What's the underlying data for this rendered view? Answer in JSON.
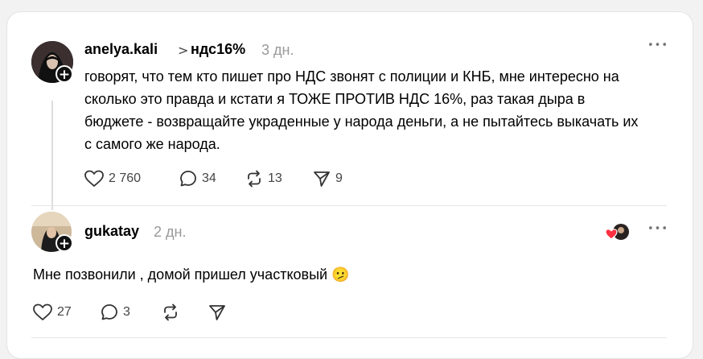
{
  "post": {
    "username": "anelya.kali",
    "separator": ">",
    "topic": "ндс16%",
    "time": "3 дн.",
    "text": "говорят, что тем кто пишет про НДС звонят с полиции и КНБ, мне интересно на сколько это правда и кстати я ТОЖЕ ПРОТИВ НДС 16%, раз такая дыра в бюджете - возвращайте украденные у народа деньги, а не пытайтесь выкачать их с самого же народа.",
    "likes": "2 760",
    "comments": "34",
    "reposts": "13",
    "shares": "9",
    "more": "•••"
  },
  "reply": {
    "username": "gukatay",
    "time": "2 дн.",
    "text": "Мне позвонили , домой пришел участковый",
    "emoji": "🫤",
    "likes": "27",
    "comments": "3",
    "more": "•••"
  },
  "icons": {
    "like": "heart-icon",
    "comment": "comment-bubble-icon",
    "repost": "repost-icon",
    "share": "send-icon",
    "follow": "plus-icon",
    "more": "more-dots-icon"
  },
  "colors": {
    "text": "#000000",
    "muted": "#999999",
    "heart": "#ff3040",
    "border": "#e3e3e3"
  }
}
